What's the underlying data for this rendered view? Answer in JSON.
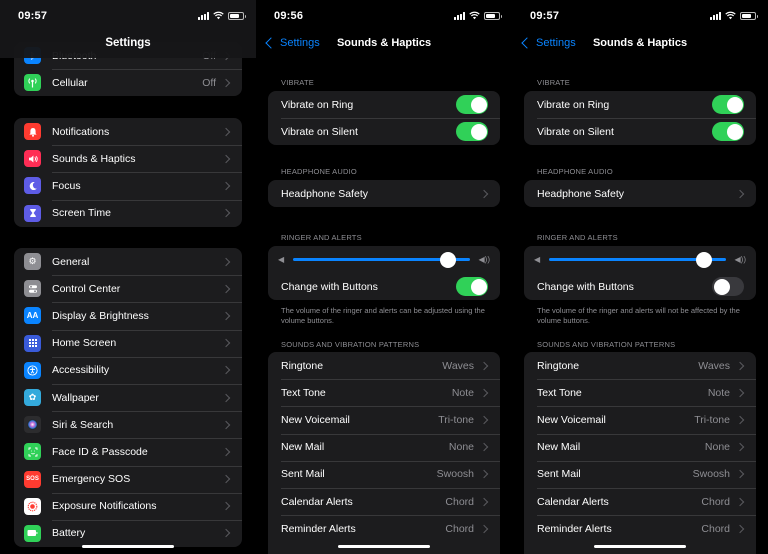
{
  "panels": [
    {
      "time": "09:57",
      "title": "Settings",
      "group0": [
        {
          "label": "Bluetooth",
          "value": "Off",
          "icon": "bluetooth-icon",
          "color": "#0a84ff"
        },
        {
          "label": "Cellular",
          "value": "Off",
          "icon": "antenna-icon",
          "color": "#30d158"
        }
      ],
      "group1": [
        {
          "label": "Notifications",
          "icon": "bell-icon",
          "color": "#ff3b30"
        },
        {
          "label": "Sounds & Haptics",
          "icon": "speaker-icon",
          "color": "#ff2d55"
        },
        {
          "label": "Focus",
          "icon": "moon-icon",
          "color": "#5e5ce6"
        },
        {
          "label": "Screen Time",
          "icon": "hourglass-icon",
          "color": "#5e5ce6"
        }
      ],
      "group2": [
        {
          "label": "General",
          "icon": "gear-icon",
          "color": "#8e8e93"
        },
        {
          "label": "Control Center",
          "icon": "toggles-icon",
          "color": "#8e8e93"
        },
        {
          "label": "Display & Brightness",
          "icon": "text-size-icon",
          "color": "#0a84ff"
        },
        {
          "label": "Home Screen",
          "icon": "grid-icon",
          "color": "#3a5bd9"
        },
        {
          "label": "Accessibility",
          "icon": "accessibility-icon",
          "color": "#0a84ff"
        },
        {
          "label": "Wallpaper",
          "icon": "flower-icon",
          "color": "#34aadc"
        },
        {
          "label": "Siri & Search",
          "icon": "siri-icon",
          "color": "#2c2c2e"
        },
        {
          "label": "Face ID & Passcode",
          "icon": "face-id-icon",
          "color": "#30d158"
        },
        {
          "label": "Emergency SOS",
          "icon": "sos-icon",
          "color": "#ff3b30"
        },
        {
          "label": "Exposure Notifications",
          "icon": "exposure-icon",
          "color": "#ffffff"
        },
        {
          "label": "Battery",
          "icon": "battery-icon",
          "color": "#30d158"
        }
      ]
    },
    {
      "time": "09:56",
      "back": "Settings",
      "title": "Sounds & Haptics",
      "vibrate_header": "VIBRATE",
      "vibrate_ring": {
        "label": "Vibrate on Ring",
        "on": true
      },
      "vibrate_silent": {
        "label": "Vibrate on Silent",
        "on": true
      },
      "headphone_header": "HEADPHONE AUDIO",
      "headphone_safety": "Headphone Safety",
      "ringer_header": "RINGER AND ALERTS",
      "ringer_level": 0.88,
      "change_buttons": {
        "label": "Change with Buttons",
        "on": true
      },
      "ringer_footer": "The volume of the ringer and alerts can be adjusted using the volume buttons.",
      "patterns_header": "SOUNDS AND VIBRATION PATTERNS",
      "patterns": [
        {
          "label": "Ringtone",
          "value": "Waves"
        },
        {
          "label": "Text Tone",
          "value": "Note"
        },
        {
          "label": "New Voicemail",
          "value": "Tri-tone"
        },
        {
          "label": "New Mail",
          "value": "None"
        },
        {
          "label": "Sent Mail",
          "value": "Swoosh"
        },
        {
          "label": "Calendar Alerts",
          "value": "Chord"
        },
        {
          "label": "Reminder Alerts",
          "value": "Chord"
        }
      ]
    },
    {
      "time": "09:57",
      "back": "Settings",
      "title": "Sounds & Haptics",
      "vibrate_header": "VIBRATE",
      "vibrate_ring": {
        "label": "Vibrate on Ring",
        "on": true
      },
      "vibrate_silent": {
        "label": "Vibrate on Silent",
        "on": true
      },
      "headphone_header": "HEADPHONE AUDIO",
      "headphone_safety": "Headphone Safety",
      "ringer_header": "RINGER AND ALERTS",
      "ringer_level": 0.88,
      "change_buttons": {
        "label": "Change with Buttons",
        "on": false
      },
      "ringer_footer": "The volume of the ringer and alerts will not be affected by the volume buttons.",
      "patterns_header": "SOUNDS AND VIBRATION PATTERNS",
      "patterns": [
        {
          "label": "Ringtone",
          "value": "Waves"
        },
        {
          "label": "Text Tone",
          "value": "Note"
        },
        {
          "label": "New Voicemail",
          "value": "Tri-tone"
        },
        {
          "label": "New Mail",
          "value": "None"
        },
        {
          "label": "Sent Mail",
          "value": "Swoosh"
        },
        {
          "label": "Calendar Alerts",
          "value": "Chord"
        },
        {
          "label": "Reminder Alerts",
          "value": "Chord"
        }
      ]
    }
  ]
}
